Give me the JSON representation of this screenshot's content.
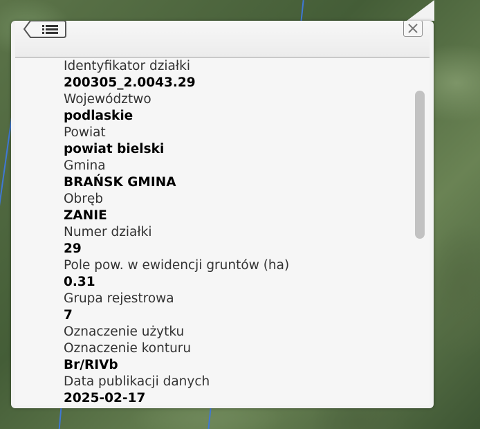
{
  "panel": {
    "back_button": "back-list-icon",
    "close_button": "close-icon"
  },
  "fields": [
    {
      "label": "Identyfikator działki",
      "value": "200305_2.0043.29"
    },
    {
      "label": "Województwo",
      "value": "podlaskie"
    },
    {
      "label": "Powiat",
      "value": "powiat bielski"
    },
    {
      "label": "Gmina",
      "value": "BRAŃSK GMINA"
    },
    {
      "label": "Obręb",
      "value": "ZANIE"
    },
    {
      "label": "Numer działki",
      "value": "29"
    },
    {
      "label": "Pole pow. w ewidencji gruntów (ha)",
      "value": "0.31"
    },
    {
      "label": "Grupa rejestrowa",
      "value": "7"
    },
    {
      "label": "Oznaczenie użytku",
      "value": ""
    },
    {
      "label": "Oznaczenie konturu",
      "value": "Br/RIVb"
    },
    {
      "label": "Data publikacji danych",
      "value": "2025-02-17"
    }
  ],
  "colors": {
    "parcel_line": "#3f78d6",
    "panel_bg": "#f3f3f3"
  }
}
